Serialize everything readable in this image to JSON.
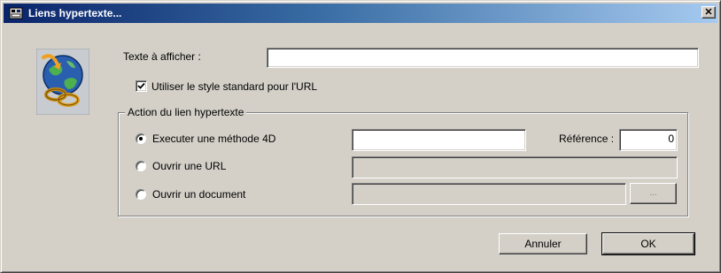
{
  "window": {
    "title": "Liens hypertexte...",
    "close_label": "✕",
    "app_icon": "window-app-icon",
    "logo_icon": "globe-chain-link-icon"
  },
  "display_text": {
    "label": "Texte à afficher :",
    "value": ""
  },
  "standard_style": {
    "label": "Utiliser le style standard pour l'URL",
    "checked": true
  },
  "action_group": {
    "title": "Action du lien hypertexte",
    "options": [
      {
        "label": "Executer une méthode 4D",
        "selected": true,
        "value": "",
        "enabled": true
      },
      {
        "label": "Ouvrir une URL",
        "selected": false,
        "value": "",
        "enabled": false
      },
      {
        "label": "Ouvrir un document",
        "selected": false,
        "value": "",
        "enabled": false
      }
    ],
    "reference": {
      "label": "Référence :",
      "value": "0"
    },
    "browse_label": "..."
  },
  "buttons": {
    "cancel": "Annuler",
    "ok": "OK"
  },
  "colors": {
    "titlebar_start": "#0a246a",
    "titlebar_end": "#a6caf0",
    "face": "#d4d0c8"
  }
}
